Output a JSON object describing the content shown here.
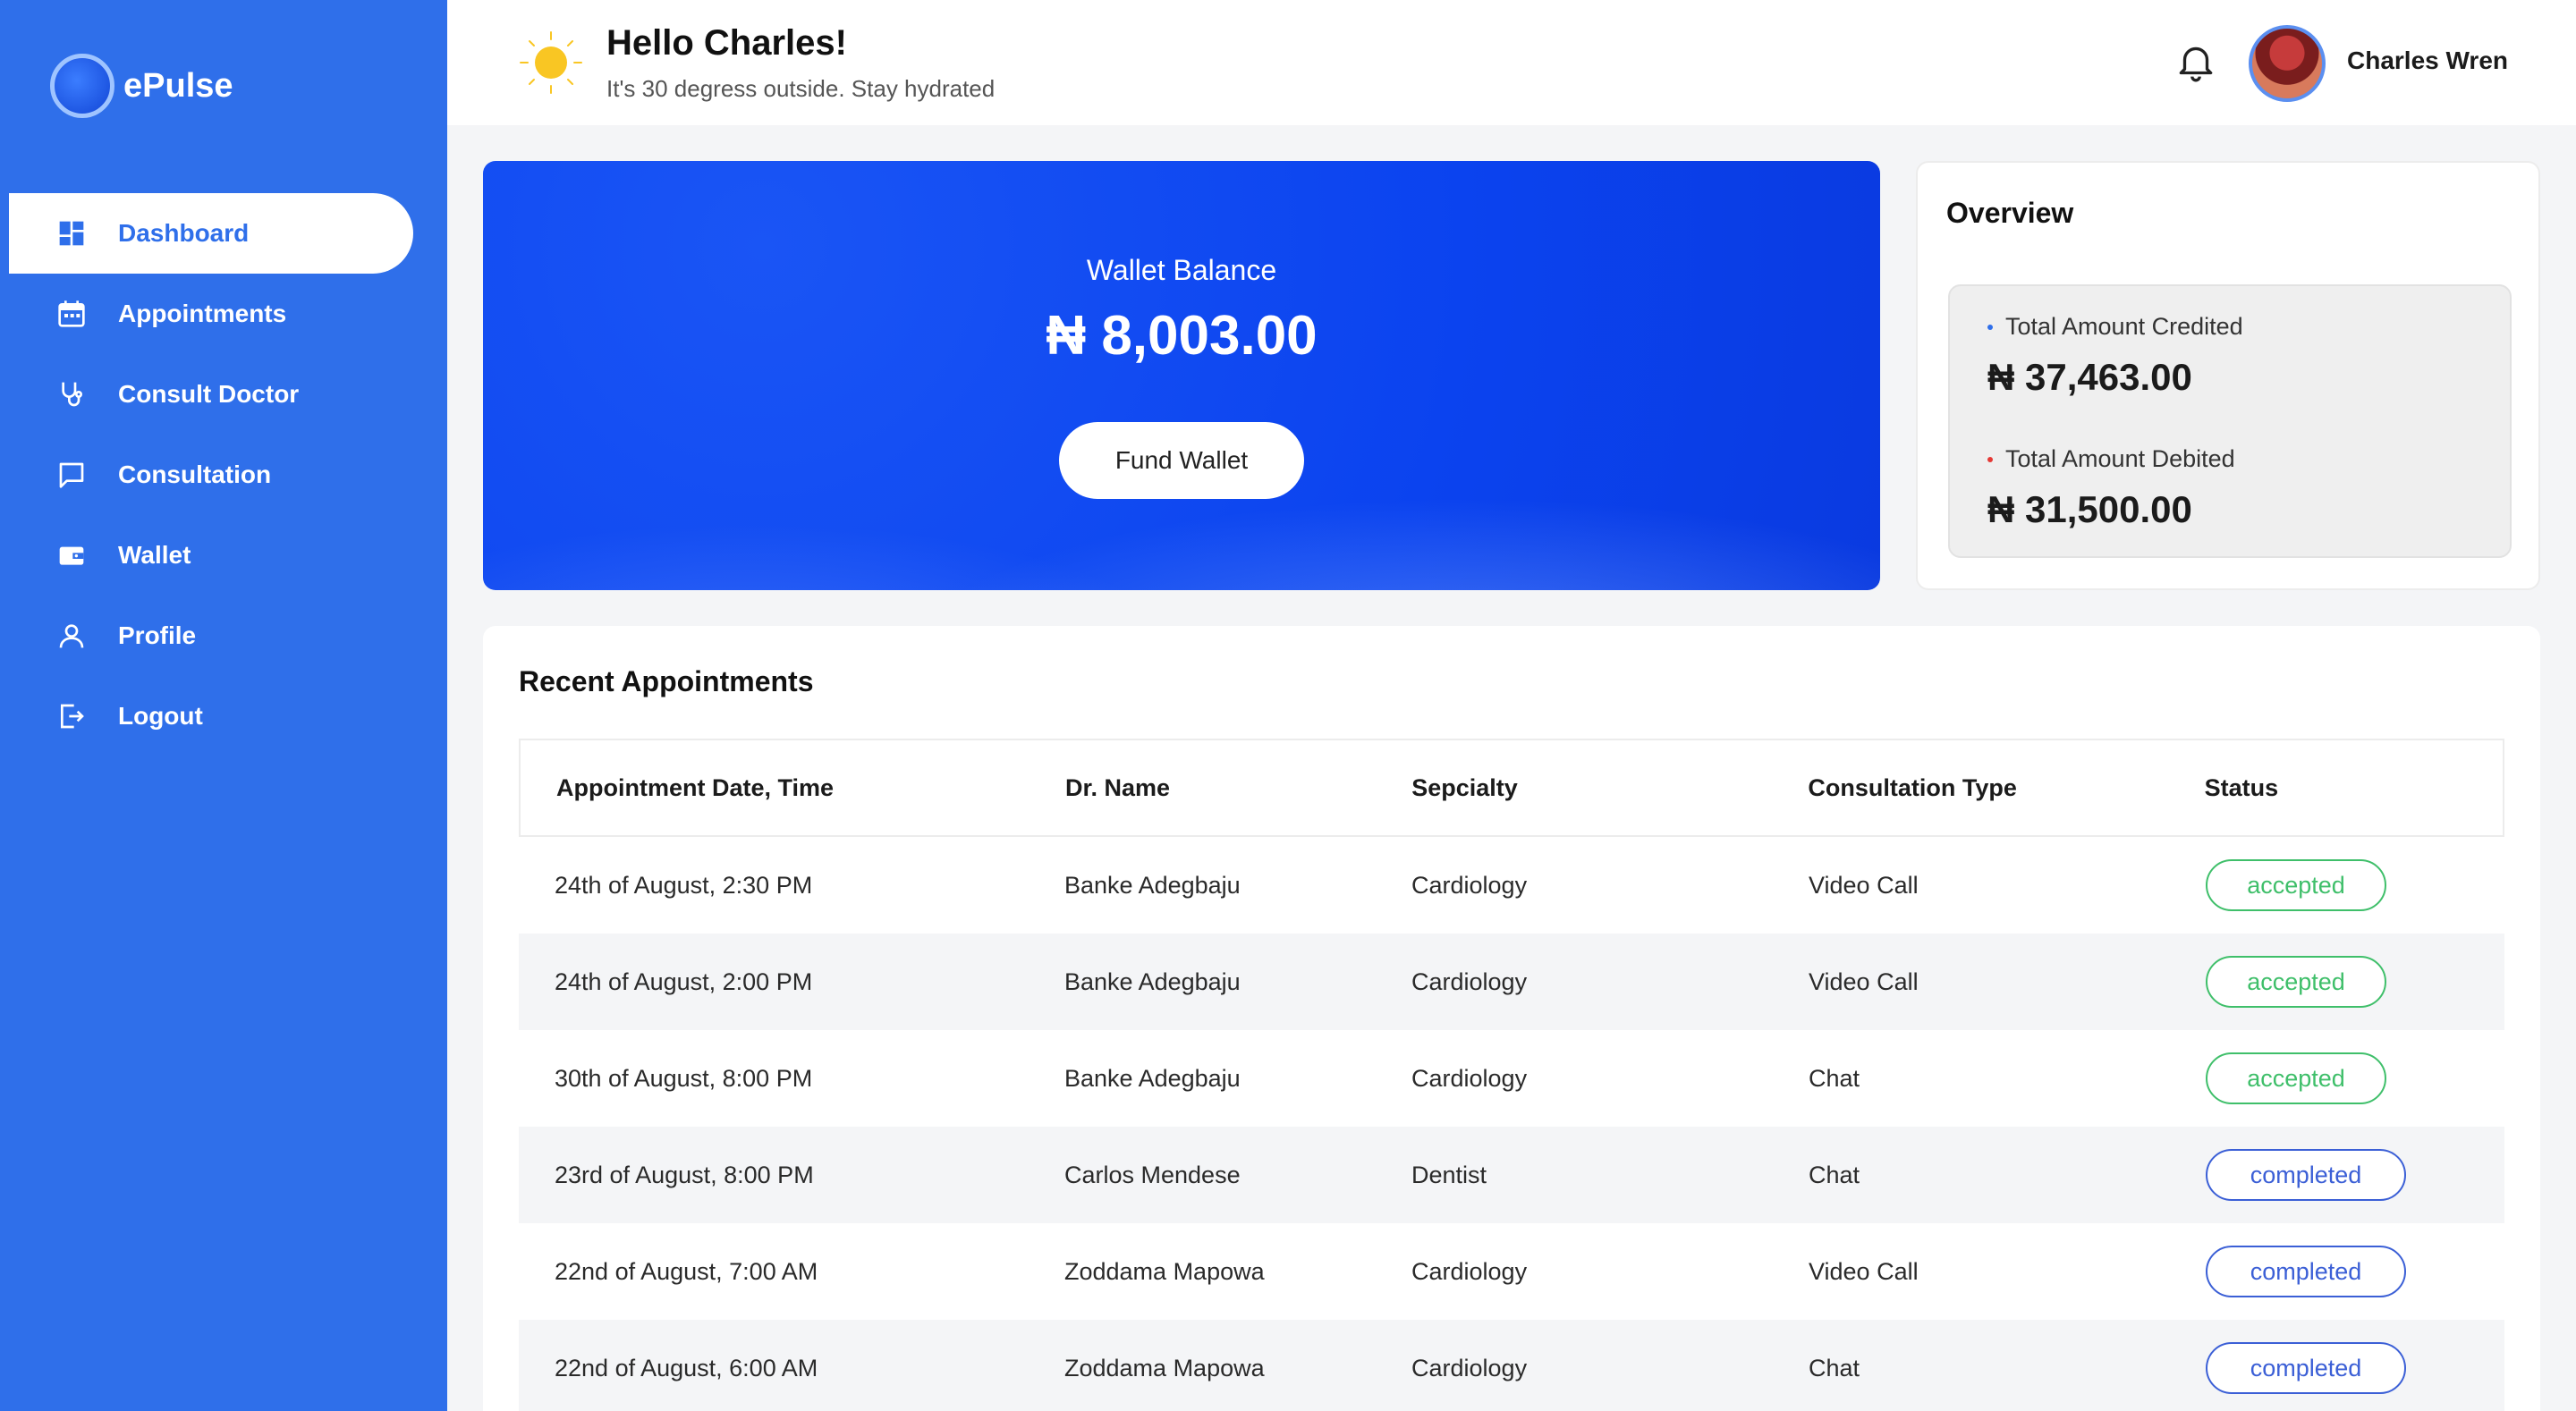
{
  "brand": {
    "name": "ePulse"
  },
  "sidebar": {
    "items": [
      {
        "label": "Dashboard",
        "icon": "dashboard-icon",
        "active": true
      },
      {
        "label": "Appointments",
        "icon": "calendar-icon",
        "active": false
      },
      {
        "label": "Consult Doctor",
        "icon": "stethoscope-icon",
        "active": false
      },
      {
        "label": "Consultation",
        "icon": "chat-icon",
        "active": false
      },
      {
        "label": "Wallet",
        "icon": "wallet-icon",
        "active": false
      },
      {
        "label": "Profile",
        "icon": "user-icon",
        "active": false
      },
      {
        "label": "Logout",
        "icon": "logout-icon",
        "active": false
      }
    ]
  },
  "header": {
    "greeting": "Hello Charles!",
    "subtitle": "It's 30 degress outside. Stay hydrated",
    "weather_icon": "sun-icon",
    "notification_icon": "bell-icon",
    "user_name": "Charles Wren"
  },
  "wallet": {
    "label": "Wallet Balance",
    "amount": "₦ 8,003.00",
    "fund_button": "Fund Wallet"
  },
  "overview": {
    "title": "Overview",
    "credited_label": "Total Amount Credited",
    "credited_amount": "₦ 37,463.00",
    "debited_label": "Total Amount Debited",
    "debited_amount": "₦ 31,500.00"
  },
  "appointments": {
    "title": "Recent Appointments",
    "columns": [
      "Appointment Date, Time",
      "Dr. Name",
      "Sepcialty",
      "Consultation Type",
      "Status"
    ],
    "rows": [
      [
        "24th of August, 2:30 PM",
        "Banke Adegbaju",
        "Cardiology",
        "Video Call",
        "accepted"
      ],
      [
        "24th of August, 2:00 PM",
        "Banke Adegbaju",
        "Cardiology",
        "Video Call",
        "accepted"
      ],
      [
        "30th of August, 8:00 PM",
        "Banke Adegbaju",
        "Cardiology",
        "Chat",
        "accepted"
      ],
      [
        "23rd of August, 8:00 PM",
        "Carlos Mendese",
        "Dentist",
        "Chat",
        "completed"
      ],
      [
        "22nd of August, 7:00 AM",
        "Zoddama Mapowa",
        "Cardiology",
        "Video Call",
        "completed"
      ],
      [
        "22nd of August, 6:00 AM",
        "Zoddama Mapowa",
        "Cardiology",
        "Chat",
        "completed"
      ]
    ]
  },
  "colors": {
    "sidebar": "#2f6fea",
    "accent": "#2f6fea",
    "wallet_card": "#0b43ef",
    "accepted": "#3fbf6a",
    "completed": "#3b5fd6",
    "credited_dot": "#2f6fea",
    "debited_dot": "#e53935"
  }
}
